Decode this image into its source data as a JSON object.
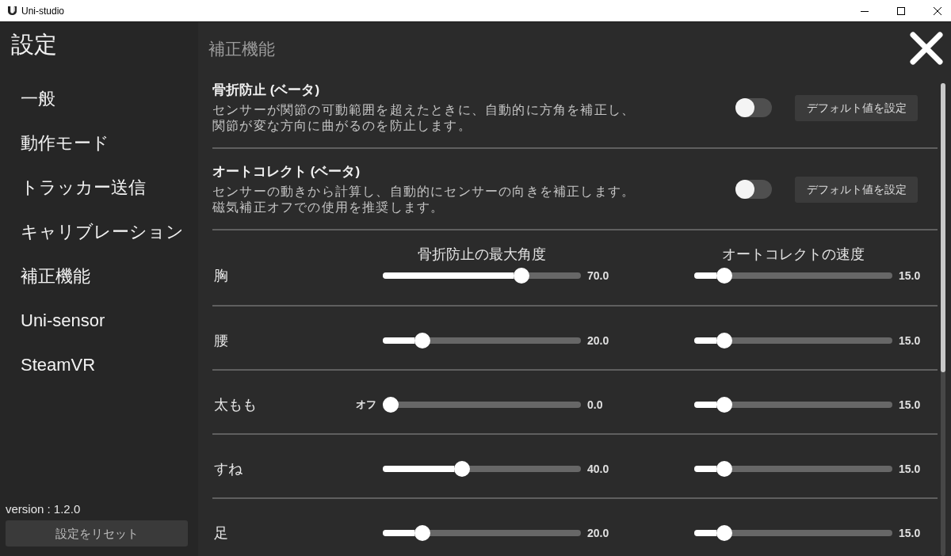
{
  "window": {
    "title": "Uni-studio"
  },
  "sidebar": {
    "title": "設定",
    "items": [
      "一般",
      "動作モード",
      "トラッカー送信",
      "キャリブレーション",
      "補正機能",
      "Uni-sensor",
      "SteamVR"
    ],
    "version": "version : 1.2.0",
    "reset_button": "設定をリセット"
  },
  "page": {
    "title": "補正機能"
  },
  "features": [
    {
      "title": "骨折防止 (ベータ)",
      "description": [
        "センサーが関節の可動範囲を超えたときに、自動的に方角を補正し、",
        "関節が変な方向に曲がるのを防止します。"
      ],
      "on": false,
      "button": "デフォルト値を設定"
    },
    {
      "title": "オートコレクト (ベータ)",
      "description": [
        "センサーの動きから計算し、自動的にセンサーの向きを補正します。",
        "磁気補正オフでの使用を推奨します。"
      ],
      "on": false,
      "button": "デフォルト値を設定"
    }
  ],
  "slider_table": {
    "columns": [
      "骨折防止の最大角度",
      "オートコレクトの速度"
    ],
    "rows": [
      {
        "label": "胸",
        "sliders": [
          {
            "level": 0.7,
            "reading": "70.0"
          },
          {
            "level": 0.15,
            "reading": "15.0"
          }
        ]
      },
      {
        "label": "腰",
        "sliders": [
          {
            "level": 0.2,
            "reading": "20.0"
          },
          {
            "level": 0.15,
            "reading": "15.0"
          }
        ]
      },
      {
        "label": "太もも",
        "sliders": [
          {
            "off_label": "オフ",
            "level": 0,
            "reading": "0.0"
          },
          {
            "level": 0.15,
            "reading": "15.0"
          }
        ]
      },
      {
        "label": "すね",
        "sliders": [
          {
            "level": 0.4,
            "reading": "40.0"
          },
          {
            "level": 0.15,
            "reading": "15.0"
          }
        ]
      },
      {
        "label": "足",
        "sliders": [
          {
            "level": 0.2,
            "reading": "20.0"
          },
          {
            "level": 0.15,
            "reading": "15.0"
          }
        ]
      }
    ]
  }
}
